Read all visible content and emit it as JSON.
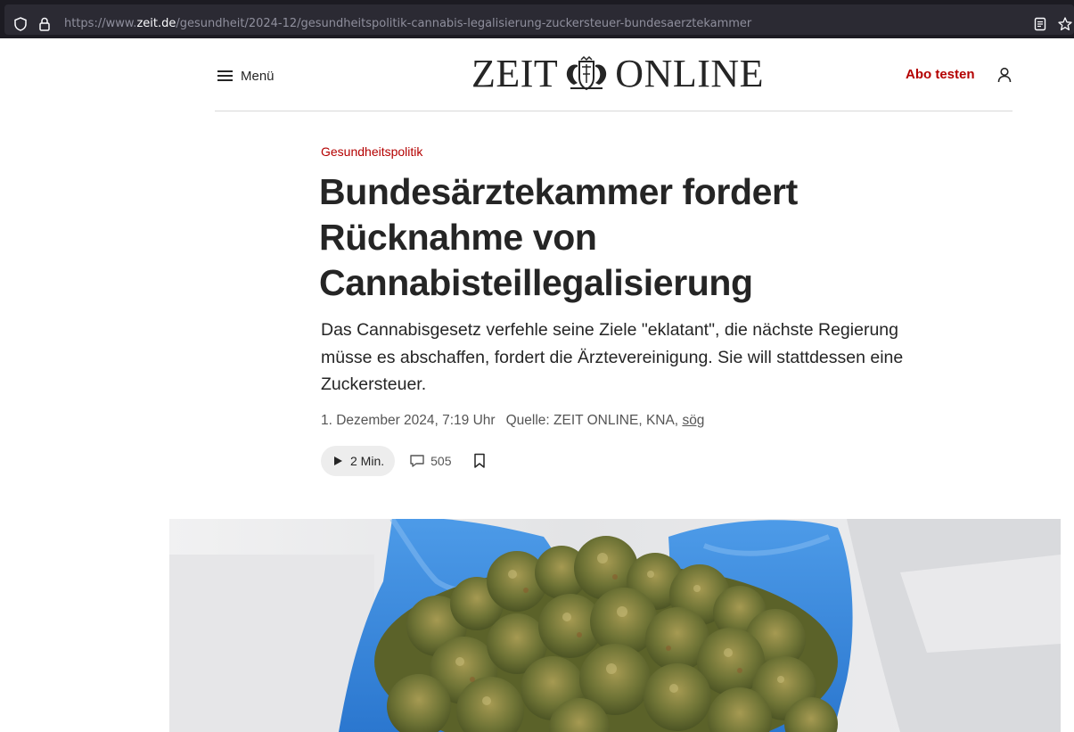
{
  "browser": {
    "url_prefix": "https://www.",
    "url_host": "zeit.de",
    "url_path": "/gesundheit/2024-12/gesundheitspolitik-cannabis-legalisierung-zuckersteuer-bundesaerztekammer"
  },
  "header": {
    "menu_label": "Menü",
    "logo_left": "ZEIT",
    "logo_right": "ONLINE",
    "abo_label": "Abo testen"
  },
  "article": {
    "kicker": "Gesundheitspolitik",
    "headline": "Bundesärztekammer fordert Rücknahme von Cannabisteillegalisierung",
    "summary": "Das Cannabisgesetz verfehle seine Ziele \"eklatant\", die nächste Regierung müsse es abschaffen, fordert die Ärztevereinigung. Sie will stattdessen eine Zuckersteuer.",
    "date": "1. Dezember 2024, 7:19 Uhr",
    "source": "Quelle: ZEIT ONLINE, KNA,",
    "author": "sög",
    "audio_label": "2 Min.",
    "comments_count": "505"
  },
  "colors": {
    "accent": "#b40000",
    "text": "#252525",
    "chrome_bg": "#1c1b22",
    "url_field_bg": "#2b2a33"
  },
  "icons": [
    "shield-icon",
    "lock-icon",
    "reader-view-icon",
    "bookmark-star-icon",
    "hamburger-icon",
    "coat-of-arms-icon",
    "user-icon",
    "play-icon",
    "comment-icon",
    "bookmark-icon"
  ]
}
